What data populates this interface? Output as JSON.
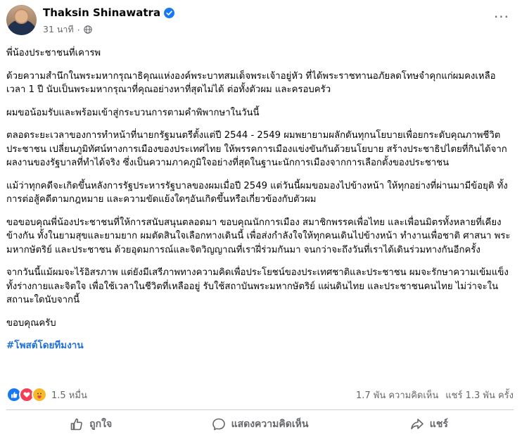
{
  "post": {
    "author": "Thaksin Shinawatra",
    "time": "31 นาที",
    "separator": "·",
    "more_label": "···",
    "paragraphs": [
      "พี่น้องประชาชนที่เคารพ",
      "ด้วยความสำนึกในพระมหากรุณาธิคุณแห่งองค์พระบาทสมเด็จพระเจ้าอยู่หัว ที่ได้พระราชทานอภัยลดโทษจำคุกแก่ผมคงเหลือเวลา 1 ปี นับเป็นพระมหากรุณาที่คุณอย่างหาที่สุดไม่ได้ ต่อทั้งตัวผม และครอบครัว",
      "ผมขอน้อมรับและพร้อมเข้าสู่กระบวนการตามคำพิพากษาในวันนี้",
      "ตลอดระยะเวลาของการทำหน้าที่นายกรัฐมนตรีตั้งแต่ปี 2544 - 2549 ผมพยายามผลักดันทุกนโยบายเพื่อยกระดับคุณภาพชีวิตประชาชน เปลี่ยนภูมิทัศน์ทางการเมืองของประเทศไทย ให้พรรคการเมืองแข่งขันกันด้วยนโยบาย สร้างประชาธิปไตยที่กินได้จากผลงานของรัฐบาลที่ทำได้จริง ซึ่งเป็นความภาคภูมิใจอย่างที่สุดในฐานะนักการเมืองจากการเลือกตั้งของประชาชน",
      "แม้ว่าทุกคดีจะเกิดขึ้นหลังการรัฐประหารรัฐบาลของผมเมื่อปี 2549 แต่วันนี้ผมขอมองไปข้างหน้า ให้ทุกอย่างที่ผ่านมามีข้อยุติ ทั้งการต่อสู้คดีตามกฎหมาย และความขัดแย้งใดๆอันเกิดขึ้นหรือเกี่ยวข้องกับตัวผม",
      "ขอขอบคุณพี่น้องประชาชนที่ให้การสนับสนุนตลอดมา ขอบคุณนักการเมือง สมาชิกพรรคเพื่อไทย และเพื่อนมิตรทั้งหลายที่เคียงข้างกัน ทั้งในยามสุขและยามยาก ผมตัดสินใจเลือกทางเดินนี้ เพื่อส่งกำลังใจให้ทุกคนเดินไปข้างหน้า ทำงานเพื่อชาติ ศาสนา พระมหากษัตริย์ และประชาชน ด้วยอุดมการณ์และจิตวิญญาณที่เราฝึ่ร่วมกันมา จนกว่าจะถึงวันที่เราได้เดินร่วมทางกันอีกครั้ง",
      "จากวันนี้แม้ผมจะไร้อิสรภาพ แต่ยังมีเสรีภาพทางความคิดเพื่อประโยชน์ของประเทศชาติและประชาชน ผมจะรักษาความเข้มแข็งทั้งร่างกายและจิตใจ เพื่อใช้เวลาในชีวิตที่เหลืออยู่ รับใช้สถาบันพระมหากษัตริย์ แผ่นดินไทย และประชาชนคนไทย ไม่ว่าจะในสถานะใดนับจากนี้",
      "ขอบคุณครับ"
    ],
    "hashtag": "#โพสต์โดยทีมงาน"
  },
  "stats": {
    "reaction_count": "1.5 หมื่น",
    "comments": "1.7 พัน ความคิดเห็น",
    "shares": "แชร์ 1.3 พัน ครั้ง",
    "reaction_types": [
      "like-icon",
      "love-icon",
      "care-icon"
    ]
  },
  "actions": {
    "like": "ถูกใจ",
    "comment": "แสดงความคิดเห็น",
    "share": "แชร์"
  },
  "colors": {
    "accent": "#1877f2",
    "secondary_text": "#65676b",
    "hashtag": "#216fdb",
    "love": "#f33e58",
    "care": "#f7b928"
  }
}
